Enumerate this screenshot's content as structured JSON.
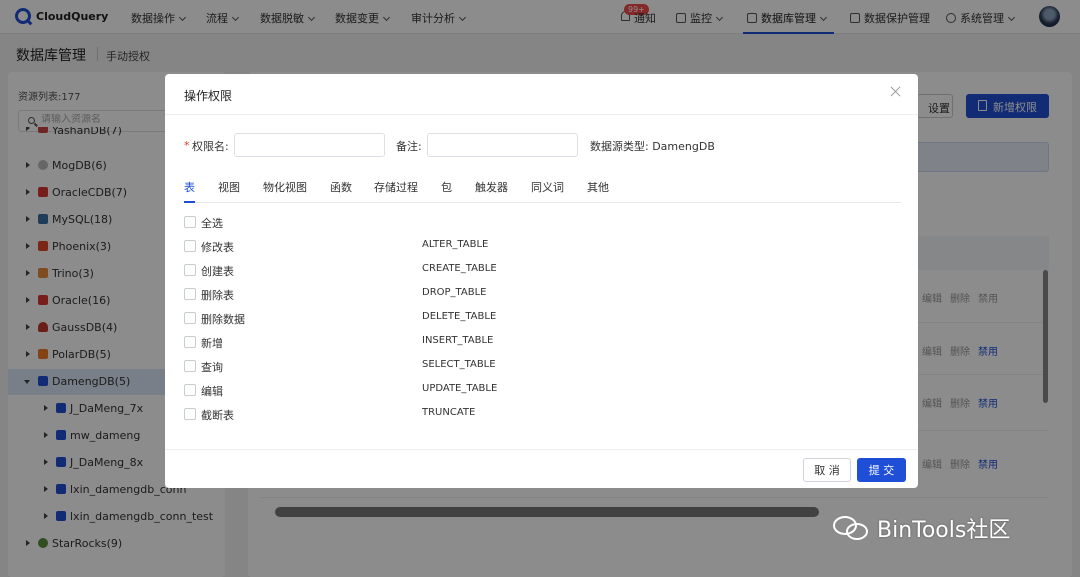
{
  "app": {
    "name": "CloudQuery"
  },
  "nav": {
    "items": [
      {
        "label": "数据操作"
      },
      {
        "label": "流程"
      },
      {
        "label": "数据脱敏"
      },
      {
        "label": "数据变更"
      },
      {
        "label": "审计分析"
      }
    ],
    "notice_label": "通知",
    "notice_badge": "99+",
    "right": [
      {
        "label": "监控",
        "icon": "monitor-icon"
      },
      {
        "label": "数据库管理",
        "icon": "database-icon"
      },
      {
        "label": "数据保护管理",
        "icon": "shield-icon"
      },
      {
        "label": "系统管理",
        "icon": "gear-icon"
      }
    ]
  },
  "page": {
    "title": "数据库管理",
    "subtitle": "手动授权"
  },
  "sidebar": {
    "resource_count": "资源列表:177",
    "search_placeholder": "请输入资源名",
    "items": [
      {
        "label": "YashanDB(7)",
        "expanded": false
      },
      {
        "label": "MogDB(6)",
        "expanded": false
      },
      {
        "label": "OracleCDB(7)",
        "expanded": false
      },
      {
        "label": "MySQL(18)",
        "expanded": false
      },
      {
        "label": "Phoenix(3)",
        "expanded": false
      },
      {
        "label": "Trino(3)",
        "expanded": false
      },
      {
        "label": "Oracle(16)",
        "expanded": false
      },
      {
        "label": "GaussDB(4)",
        "expanded": false
      },
      {
        "label": "PolarDB(5)",
        "expanded": false
      },
      {
        "label": "DamengDB(5)",
        "expanded": true,
        "selected": true
      },
      {
        "label": "J_DaMeng_7x",
        "child": true
      },
      {
        "label": "mw_dameng",
        "child": true
      },
      {
        "label": "J_DaMeng_8x",
        "child": true
      },
      {
        "label": "lxin_damengdb_conn",
        "child": true
      },
      {
        "label": "lxin_damengdb_conn_test",
        "child": true
      },
      {
        "label": "StarRocks(9)",
        "expanded": false
      }
    ]
  },
  "background": {
    "settings_label": "设置",
    "add_label": "新增权限",
    "row_actions": {
      "edit": "编辑",
      "delete": "删除",
      "disable": "禁用"
    }
  },
  "modal": {
    "title": "操作权限",
    "name_label": "权限名:",
    "name_value": "",
    "remark_label": "备注:",
    "remark_value": "",
    "ds_type": "数据源类型: DamengDB",
    "tabs": [
      {
        "label": "表",
        "active": true
      },
      {
        "label": "视图"
      },
      {
        "label": "物化视图"
      },
      {
        "label": "函数"
      },
      {
        "label": "存储过程"
      },
      {
        "label": "包"
      },
      {
        "label": "触发器"
      },
      {
        "label": "同义词"
      },
      {
        "label": "其他"
      }
    ],
    "select_all": "全选",
    "permissions": [
      {
        "name": "修改表",
        "code": "ALTER_TABLE"
      },
      {
        "name": "创建表",
        "code": "CREATE_TABLE"
      },
      {
        "name": "删除表",
        "code": "DROP_TABLE"
      },
      {
        "name": "删除数据",
        "code": "DELETE_TABLE"
      },
      {
        "name": "新增",
        "code": "INSERT_TABLE"
      },
      {
        "name": "查询",
        "code": "SELECT_TABLE"
      },
      {
        "name": "编辑",
        "code": "UPDATE_TABLE"
      },
      {
        "name": "截断表",
        "code": "TRUNCATE"
      }
    ],
    "cancel_label": "取 消",
    "submit_label": "提 交"
  },
  "watermark": "BinTools社区",
  "colors": {
    "accent": "#1f4fd6",
    "danger": "#f04a4a",
    "selected_bg": "#dde8f7"
  }
}
